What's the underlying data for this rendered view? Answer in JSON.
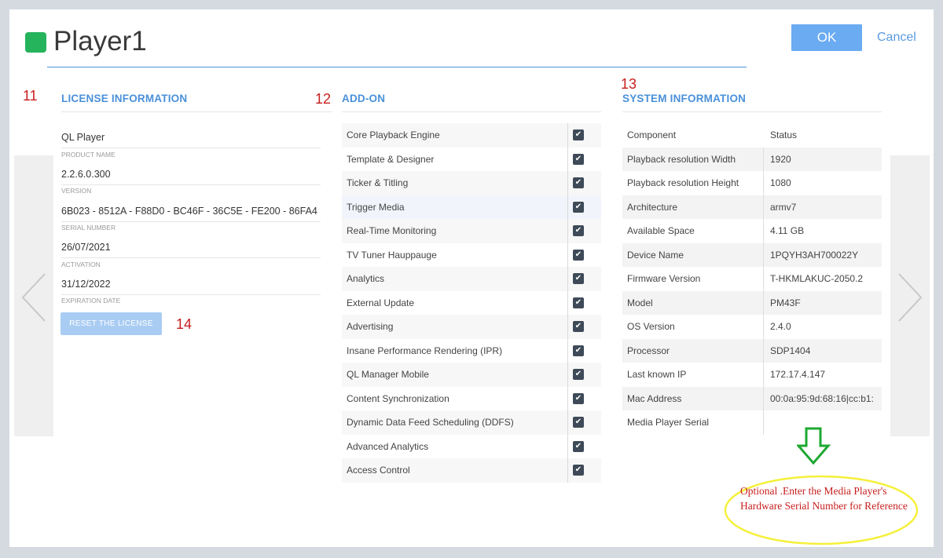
{
  "header": {
    "title": "Player1",
    "status_color": "#25b35c",
    "ok_label": "OK",
    "cancel_label": "Cancel"
  },
  "colors": {
    "accent": "#4a90d9",
    "ok_button": "#6aabf2",
    "reset_button": "#a9ccf3",
    "annotation": "#c81e1e",
    "callout_ellipse": "#f5f03a",
    "callout_arrow": "#1ea832"
  },
  "annotations": {
    "license": "11",
    "addon": "12",
    "system": "13",
    "reset": "14"
  },
  "license": {
    "title": "LICENSE INFORMATION",
    "fields": [
      {
        "value": "QL Player",
        "label": "PRODUCT NAME"
      },
      {
        "value": "2.2.6.0.300",
        "label": "VERSION"
      },
      {
        "value": "6B023 - 8512A - F88D0 - BC46F - 36C5E - FE200 - 86FA4",
        "label": "SERIAL NUMBER"
      },
      {
        "value": "26/07/2021",
        "label": "ACTIVATION"
      },
      {
        "value": "31/12/2022",
        "label": "EXPIRATION DATE"
      }
    ],
    "reset_label": "RESET THE LICENSE"
  },
  "addon": {
    "title": "ADD-ON",
    "items": [
      {
        "name": "Core Playback Engine",
        "checked": true
      },
      {
        "name": "Template & Designer",
        "checked": true
      },
      {
        "name": "Ticker & Titling",
        "checked": true
      },
      {
        "name": "Trigger Media",
        "checked": true
      },
      {
        "name": "Real-Time Monitoring",
        "checked": true
      },
      {
        "name": "TV Tuner Hauppauge",
        "checked": true
      },
      {
        "name": "Analytics",
        "checked": true
      },
      {
        "name": "External Update",
        "checked": true
      },
      {
        "name": "Advertising",
        "checked": true
      },
      {
        "name": "Insane Performance Rendering (IPR)",
        "checked": true
      },
      {
        "name": "QL Manager Mobile",
        "checked": true
      },
      {
        "name": "Content Synchronization",
        "checked": true
      },
      {
        "name": "Dynamic Data Feed Scheduling (DDFS)",
        "checked": true
      },
      {
        "name": "Advanced Analytics",
        "checked": true
      },
      {
        "name": "Access Control",
        "checked": true
      }
    ]
  },
  "system": {
    "title": "SYSTEM INFORMATION",
    "columns": [
      "Component",
      "Status"
    ],
    "rows": [
      {
        "component": "Playback resolution Width",
        "status": "1920"
      },
      {
        "component": "Playback resolution Height",
        "status": "1080"
      },
      {
        "component": "Architecture",
        "status": "armv7"
      },
      {
        "component": "Available Space",
        "status": "4.11 GB"
      },
      {
        "component": "Device Name",
        "status": "1PQYH3AH700022Y"
      },
      {
        "component": "Firmware Version",
        "status": "T-HKMLAKUC-2050.2"
      },
      {
        "component": "Model",
        "status": "PM43F"
      },
      {
        "component": "OS Version",
        "status": "2.4.0"
      },
      {
        "component": "Processor",
        "status": "SDP1404"
      },
      {
        "component": "Last known IP",
        "status": "172.17.4.147"
      },
      {
        "component": "Mac Address",
        "status": "00:0a:95:9d:68:16|cc:b1:"
      },
      {
        "component": "Media Player Serial",
        "status": ""
      }
    ]
  },
  "callout": {
    "text": "Optional .Enter the Media Player's Hardware Serial Number for Reference"
  }
}
